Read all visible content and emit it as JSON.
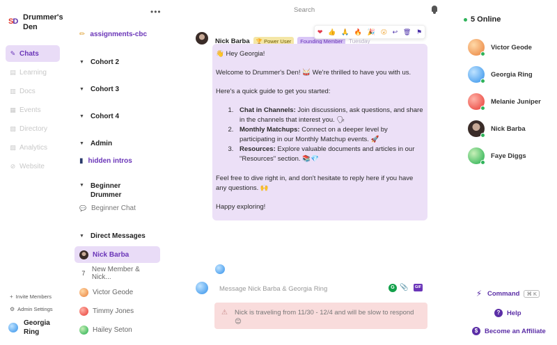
{
  "workspace": {
    "name": "Drummer's Den",
    "logo_text": "SD"
  },
  "nav": {
    "items": [
      {
        "label": "Chats",
        "icon": "feather-icon",
        "glyph": "✎",
        "active": true
      },
      {
        "label": "Learning",
        "icon": "book-icon",
        "glyph": "▤",
        "active": false
      },
      {
        "label": "Docs",
        "icon": "doc-icon",
        "glyph": "▥",
        "active": false
      },
      {
        "label": "Events",
        "icon": "calendar-icon",
        "glyph": "▦",
        "active": false
      },
      {
        "label": "Directory",
        "icon": "directory-icon",
        "glyph": "▧",
        "active": false
      },
      {
        "label": "Analytics",
        "icon": "chart-icon",
        "glyph": "▨",
        "active": false
      },
      {
        "label": "Website",
        "icon": "link-icon",
        "glyph": "⊘",
        "active": false
      }
    ],
    "invite": "Invite Members",
    "admin_settings": "Admin Settings"
  },
  "current_user": {
    "name": "Georgia Ring"
  },
  "channels": {
    "pinned": {
      "label": "assignments-cbc",
      "emoji": "✏"
    },
    "groups": [
      {
        "label": "Cohort 2"
      },
      {
        "label": "Cohort 3"
      },
      {
        "label": "Cohort 4"
      },
      {
        "label": "Admin"
      },
      {
        "label": "Beginner Drummer"
      }
    ],
    "admin_link": {
      "label": "hidden intros",
      "emoji": "▮"
    },
    "beginner_chat": {
      "label": "Beginner Chat",
      "emoji": "💬"
    },
    "dm_header": "Direct Messages",
    "dms": [
      {
        "label": "Nick Barba",
        "active": true
      },
      {
        "label": "New Member & Nick...",
        "count": "7"
      },
      {
        "label": "Victor Geode"
      },
      {
        "label": "Timmy Jones"
      },
      {
        "label": "Hailey Seton"
      }
    ]
  },
  "header": {
    "search_placeholder": "Search",
    "more_label": "•••"
  },
  "message": {
    "author": "Nick Barba",
    "badge_power": "🏆 Power User",
    "badge_founding": "Founding Member",
    "time": "Tuesday",
    "greeting": "👋 Hey Georgia!",
    "intro": "Welcome to Drummer's Den! 🥁 We're thrilled to have you with us.",
    "guide_intro": "Here's a quick guide to get you started:",
    "list": [
      {
        "title": "Chat in Channels:",
        "text": " Join discussions, ask questions, and share in the channels that interest you. 🗣"
      },
      {
        "title": "Monthly Matchups:",
        "text": " Connect on a deeper level by participating in our Monthly Matchup events. 🚀"
      },
      {
        "title": "Resources:",
        "text": " Explore valuable documents and articles in our \"Resources\" section. 📚💎"
      }
    ],
    "closing": "Feel free to dive right in, and don't hesitate to reply here if you have any questions. 🙌",
    "signoff": "Happy exploring!"
  },
  "reactions": [
    "❤",
    "👍",
    "🙏",
    "🔥",
    "🎉",
    "😮",
    "↩",
    "🗑",
    "⚑"
  ],
  "composer": {
    "placeholder": "Message Nick Barba & Georgia Ring",
    "grammarly": "G",
    "attach": "📎",
    "gif": "GIF"
  },
  "status_banner": {
    "icon": "⚠",
    "text": "Nick is traveling from 11/30 - 12/4 and will be slow to respond 😊"
  },
  "online": {
    "title": "5 Online",
    "users": [
      {
        "name": "Victor Geode",
        "color": "orange"
      },
      {
        "name": "Georgia Ring",
        "color": "blue"
      },
      {
        "name": "Melanie Juniper",
        "color": "red"
      },
      {
        "name": "Nick Barba",
        "color": "dark"
      },
      {
        "name": "Faye Diggs",
        "color": "green"
      }
    ]
  },
  "right_links": {
    "command": "Command",
    "command_kbd": "⌘ K",
    "help": "Help",
    "affiliate": "Become an Affiliate"
  }
}
